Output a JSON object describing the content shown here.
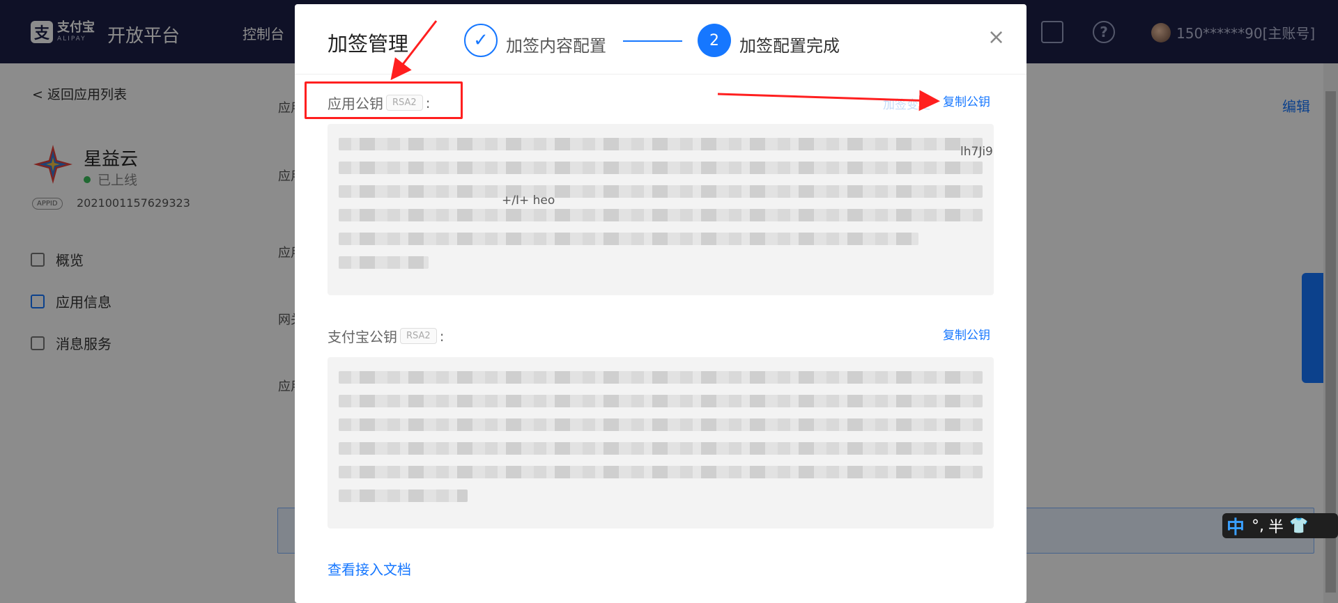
{
  "topbar": {
    "logo_mark": "支",
    "logo_cn": "支付宝",
    "logo_en": "ALIPAY",
    "platform_title": "开放平台",
    "nav_console": "控制台",
    "help_glyph": "?",
    "user_account": "150******90[主账号]"
  },
  "sidebar": {
    "back_label": "返回应用列表",
    "back_glyph": "<",
    "app_name": "星益云",
    "app_status": "已上线",
    "appid_tag": "APPID",
    "appid_value": "2021001157629323",
    "menu": [
      {
        "label": "概览",
        "icon": "chart-icon"
      },
      {
        "label": "应用信息",
        "icon": "grid-icon"
      },
      {
        "label": "消息服务",
        "icon": "message-icon"
      }
    ]
  },
  "main": {
    "labels": [
      "应用",
      "应用",
      "应用",
      "网关",
      "应用"
    ],
    "edit_label": "编辑"
  },
  "modal": {
    "title": "加签管理",
    "step1_glyph": "✓",
    "step1_label": "加签内容配置",
    "step2_number": "2",
    "step2_label": "加签配置完成",
    "close_glyph": "×",
    "app_key": {
      "label": "应用公钥",
      "tag": "RSA2",
      "colon": ":",
      "faded_action": "加签变更",
      "copy_label": "复制公钥",
      "visible_fragment_1": "lh7Ji9",
      "visible_fragment_2": "+/I+ heo"
    },
    "alipay_key": {
      "label": "支付宝公钥",
      "tag": "RSA2",
      "colon": ":",
      "copy_label": "复制公钥"
    },
    "doc_link": "查看接入文档"
  },
  "ime": {
    "mode": "中",
    "punct": "°,",
    "width": "半"
  },
  "colors": {
    "accent": "#1677ff",
    "topbar": "#1d2047",
    "annotation": "#ff1f1f"
  }
}
